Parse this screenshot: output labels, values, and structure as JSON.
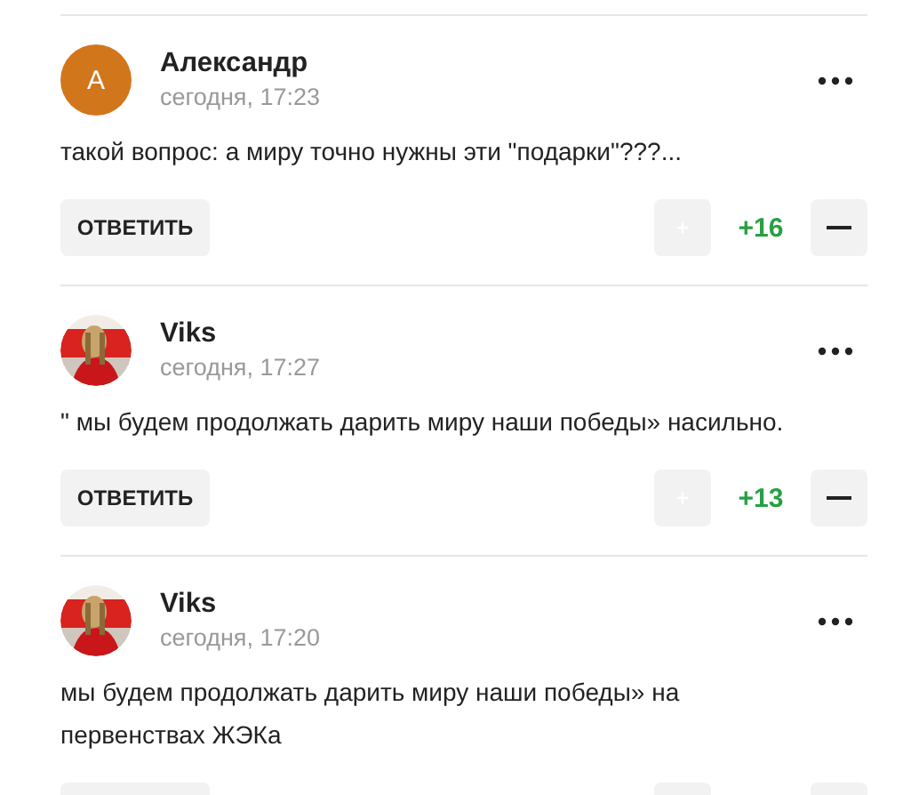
{
  "comments": [
    {
      "author": "Александр",
      "avatar": {
        "kind": "letter",
        "letter": "А",
        "color": "#d2761c"
      },
      "time": "сегодня, 17:23",
      "text": "такой вопрос: а миру точно нужны эти \"подарки\"???...",
      "reply_label": "ОТВЕТИТЬ",
      "score": "+16"
    },
    {
      "author": "Viks",
      "time": "сегодня, 17:27",
      "text": "\" мы будем продолжать дарить миру наши победы» насильно.",
      "reply_label": "ОТВЕТИТЬ",
      "score": "+13"
    },
    {
      "author": "Viks",
      "time": "сегодня, 17:20",
      "text": "мы будем продолжать дарить миру наши победы» на\nпервенствах ЖЭКа"
    }
  ]
}
